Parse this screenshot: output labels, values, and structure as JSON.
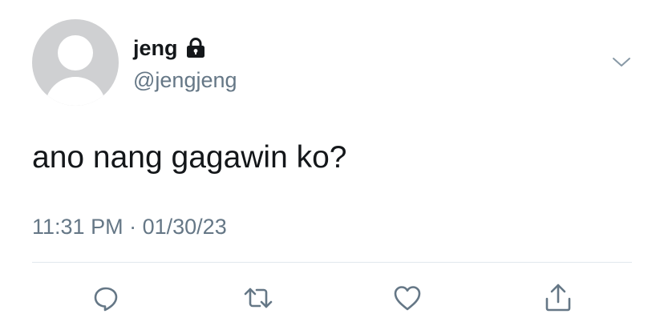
{
  "author": {
    "display_name": "jeng",
    "username": "@jengjeng",
    "protected_icon": "lock-icon"
  },
  "tweet": {
    "text": "ano nang gagawin ko?",
    "time": "11:31 PM",
    "separator": "·",
    "date": "01/30/23"
  },
  "actions": [
    {
      "name": "reply",
      "icon": "reply-icon"
    },
    {
      "name": "retweet",
      "icon": "retweet-icon"
    },
    {
      "name": "like",
      "icon": "heart-icon"
    },
    {
      "name": "share",
      "icon": "share-icon"
    }
  ],
  "colors": {
    "text": "#14171a",
    "secondary": "#657786",
    "icon": "#657786",
    "divider": "#e1e8ed",
    "avatar": "#cfd0d2"
  }
}
